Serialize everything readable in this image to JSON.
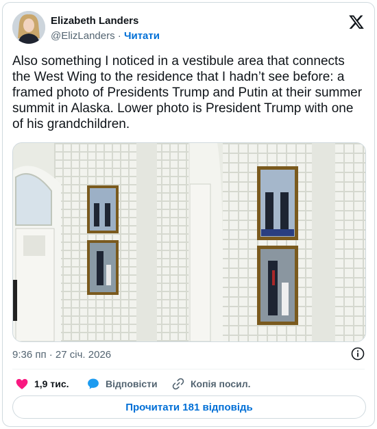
{
  "author": {
    "name": "Elizabeth Landers",
    "handle": "@ElizLanders",
    "separator": "·",
    "follow_label": "Читати"
  },
  "tweet": {
    "text": "Also something I noticed in a vestibule area that connects the West Wing to the residence that I hadn’t see before: a framed photo of Presidents Trump and Putin at their summer summit in Alaska. Lower photo is President Trump with one of his grandchildren."
  },
  "timestamp": "9:36 пп · 27 січ. 2026",
  "actions": {
    "likes": "1,9 тис.",
    "reply": "Відповісти",
    "copy_link": "Копія посил."
  },
  "read_replies": "Прочитати 181 відповідь",
  "colors": {
    "accent": "#006fd6",
    "like": "#f91880",
    "reply": "#1d9bf0",
    "secondary_text": "#536471",
    "border": "#cfd9de"
  },
  "icons": [
    "x-logo-icon",
    "info-icon",
    "heart-icon",
    "reply-bubble-icon",
    "link-icon"
  ]
}
